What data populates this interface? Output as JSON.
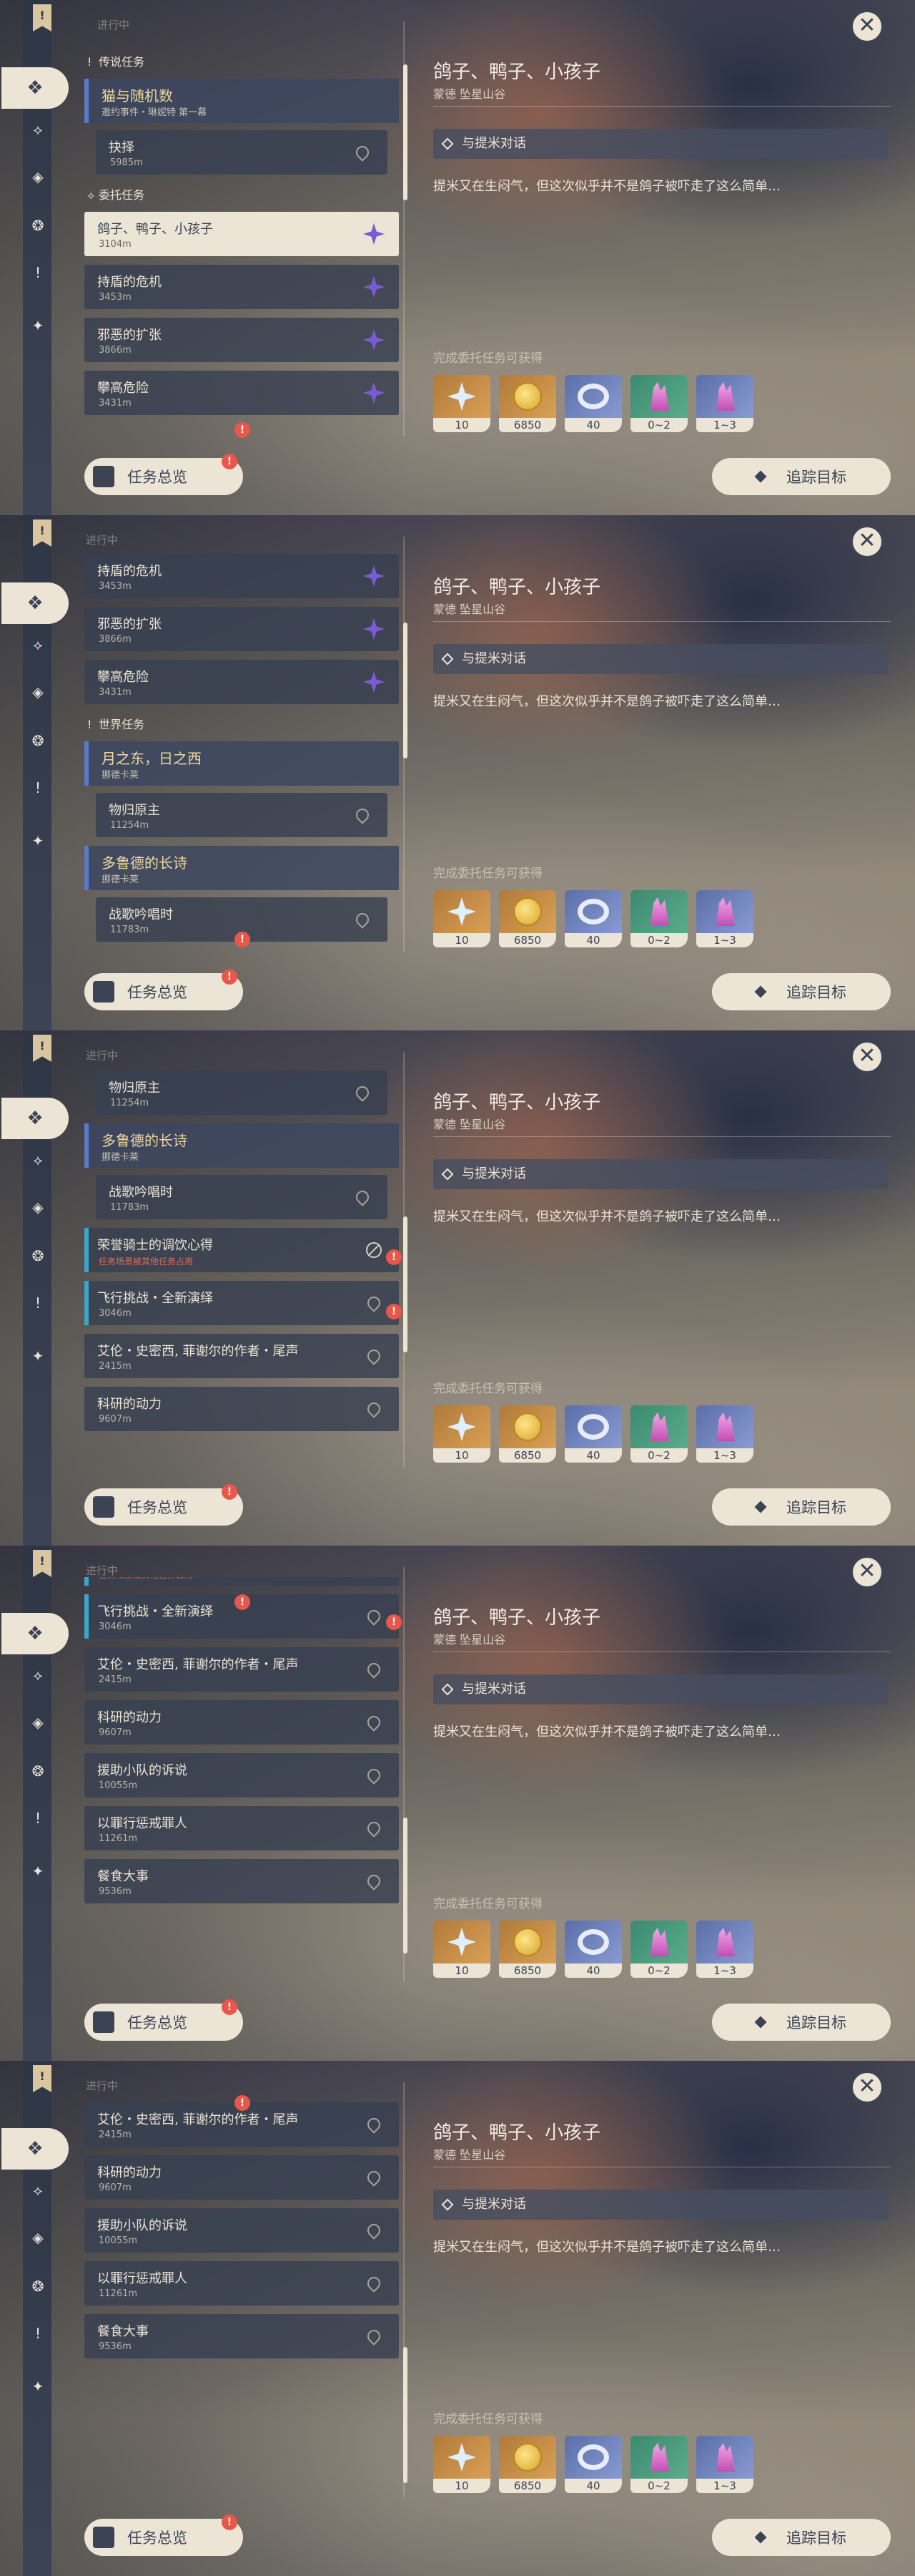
{
  "common": {
    "section_label": "进行中",
    "close_label": "✕",
    "overview_label": "任务总览",
    "track_label": "追踪目标",
    "badge_label": "!"
  },
  "detail": {
    "title": "鸽子、鸭子、小孩子",
    "location": "蒙德 坠星山谷",
    "objective": "与提米对话",
    "description": "提米又在生闷气，但这次似乎并不是鸽子被吓走了这么简单…",
    "rewards_label": "完成委托任务可获得",
    "rewards": [
      {
        "icon": "primogem-icon",
        "count": "10"
      },
      {
        "icon": "mora-icon",
        "count": "6850"
      },
      {
        "icon": "exp-ring-icon",
        "count": "40"
      },
      {
        "icon": "crystal-icon",
        "count": "0~2"
      },
      {
        "icon": "crystal-cluster-icon",
        "count": "1~3"
      }
    ]
  },
  "legend": {
    "group": "传说任务",
    "quest_title": "猫与随机数",
    "quest_sub": "邀约事件・琳妮特 第一幕",
    "step": "抉择",
    "step_dist": "5985m"
  },
  "commission": {
    "group": "委托任务",
    "items": [
      {
        "title": "鸽子、鸭子、小孩子",
        "dist": "3104m"
      },
      {
        "title": "持盾的危机",
        "dist": "3453m"
      },
      {
        "title": "邪恶的扩张",
        "dist": "3866m"
      },
      {
        "title": "攀高危险",
        "dist": "3431m"
      }
    ]
  },
  "world": {
    "group": "世界任务",
    "q1_title": "月之东，日之西",
    "q1_sub": "挪德卡莱",
    "q1_step": "物归原主",
    "q1_step_dist": "11254m",
    "q2_title": "多鲁德的长诗",
    "q2_sub": "挪德卡莱",
    "q2_step": "战歌吟唱时",
    "q2_step_dist": "11783m",
    "items": [
      {
        "title": "荣誉骑士的调饮心得",
        "dist": "",
        "warn": "任务场景被其他任务占用"
      },
      {
        "title": "飞行挑战・全新演绎",
        "dist": "3046m"
      },
      {
        "title": "艾伦・史密西, 菲谢尔的作者・尾声",
        "dist": "2415m"
      },
      {
        "title": "科研的动力",
        "dist": "9607m"
      },
      {
        "title": "援助小队的诉说",
        "dist": "10055m"
      },
      {
        "title": "以罪行惩戒罪人",
        "dist": "11261m"
      },
      {
        "title": "餐食大事",
        "dist": "9536m"
      }
    ]
  }
}
